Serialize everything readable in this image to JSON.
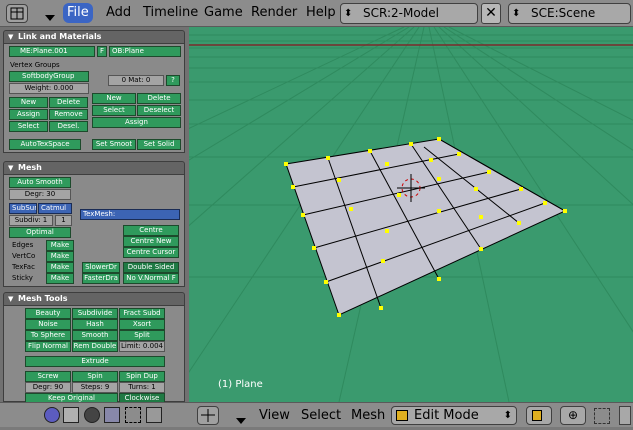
{
  "topbar": {
    "menus": [
      "File",
      "Add",
      "Timeline",
      "Game",
      "Render",
      "Help"
    ],
    "screen_field": "SCR:2-Model",
    "scene_field": "SCE:Scene"
  },
  "link_panel": {
    "title": "Link and Materials",
    "mesh_name": "ME:Plane.001",
    "f_label": "F",
    "ob_name": "OB:Plane",
    "vertex_groups_label": "Vertex Groups",
    "group_name": "SoftbodyGroup",
    "weight": "Weight: 0.000",
    "mat_field": "0 Mat: 0",
    "question": "?",
    "vg_buttons": [
      "New",
      "Delete",
      "Assign",
      "Remove",
      "Select",
      "Desel."
    ],
    "mat_buttons": [
      "New",
      "Delete",
      "Select",
      "Deselect"
    ],
    "mat_assign": "Assign",
    "autotex": "AutoTexSpace",
    "set_smooth": "Set Smoot",
    "set_solid": "Set Solid"
  },
  "mesh_panel": {
    "title": "Mesh",
    "auto_smooth": "Auto Smooth",
    "degr": "Degr: 30",
    "subsurf": "SubSurf",
    "catmul": "Catmul",
    "subdiv": "Subdiv: 1",
    "subdiv2": "1",
    "texmesh": "TexMesh:",
    "optimal": "Optimal",
    "centre": "Centre",
    "centre_new": "Centre New",
    "centre_cursor": "Centre Cursor",
    "row_labels": [
      "Edges",
      "VertCo",
      "TexFac",
      "Sticky"
    ],
    "make": "Make",
    "slower": "SlowerDr",
    "faster": "FasterDra",
    "double_sided": "Double Sided",
    "no_vnormal": "No V.Normal F"
  },
  "tools_panel": {
    "title": "Mesh Tools",
    "row1": [
      "Beauty",
      "Subdivide",
      "Fract Subd"
    ],
    "row2": [
      "Noise",
      "Hash",
      "Xsort"
    ],
    "row3": [
      "To Sphere",
      "Smooth",
      "Split"
    ],
    "row4": [
      "Flip Normal",
      "Rem Double",
      "Limit: 0.004"
    ],
    "extrude": "Extrude",
    "row5": [
      "Screw",
      "Spin",
      "Spin Dup"
    ],
    "row6": [
      "Degr: 90",
      "Steps: 9",
      "Turns: 1"
    ],
    "keep_original": "Keep Original",
    "clockwise": "Clockwise"
  },
  "viewport": {
    "object_label": "(1) Plane"
  },
  "bottombar": {
    "menus": [
      "View",
      "Select",
      "Mesh"
    ],
    "mode": "Edit Mode"
  },
  "colors": {
    "viewport_bg": "#3a9a6e",
    "button_green": "#2f9a5c",
    "selected_blue": "#3b65c4",
    "vertex_yellow": "#ffff00",
    "plane_fill": "#c4c4d0"
  }
}
